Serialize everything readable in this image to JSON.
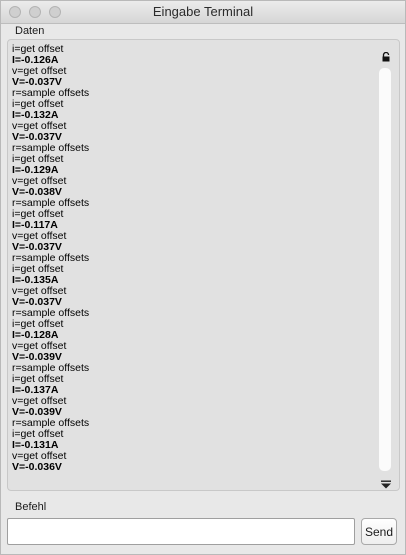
{
  "window": {
    "title": "Eingabe Terminal"
  },
  "output_section": {
    "label": "Daten"
  },
  "input_section": {
    "label": "Befehl"
  },
  "command_input": {
    "value": "",
    "placeholder": ""
  },
  "send_button": {
    "label": "Send"
  },
  "icons": {
    "lock": "lock-icon",
    "scroll_down": "chevron-down-icon"
  },
  "log_lines": [
    {
      "text": "i=get offset",
      "bold": false
    },
    {
      "text": "I=-0.126A",
      "bold": true
    },
    {
      "text": "v=get offset",
      "bold": false
    },
    {
      "text": "V=-0.037V",
      "bold": true
    },
    {
      "text": "r=sample offsets",
      "bold": false
    },
    {
      "text": "i=get offset",
      "bold": false
    },
    {
      "text": "I=-0.132A",
      "bold": true
    },
    {
      "text": "v=get offset",
      "bold": false
    },
    {
      "text": "V=-0.037V",
      "bold": true
    },
    {
      "text": "r=sample offsets",
      "bold": false
    },
    {
      "text": "i=get offset",
      "bold": false
    },
    {
      "text": "I=-0.129A",
      "bold": true
    },
    {
      "text": "v=get offset",
      "bold": false
    },
    {
      "text": "V=-0.038V",
      "bold": true
    },
    {
      "text": "r=sample offsets",
      "bold": false
    },
    {
      "text": "i=get offset",
      "bold": false
    },
    {
      "text": "I=-0.117A",
      "bold": true
    },
    {
      "text": "v=get offset",
      "bold": false
    },
    {
      "text": "V=-0.037V",
      "bold": true
    },
    {
      "text": "r=sample offsets",
      "bold": false
    },
    {
      "text": "i=get offset",
      "bold": false
    },
    {
      "text": "I=-0.135A",
      "bold": true
    },
    {
      "text": "v=get offset",
      "bold": false
    },
    {
      "text": "V=-0.037V",
      "bold": true
    },
    {
      "text": "r=sample offsets",
      "bold": false
    },
    {
      "text": "i=get offset",
      "bold": false
    },
    {
      "text": "I=-0.128A",
      "bold": true
    },
    {
      "text": "v=get offset",
      "bold": false
    },
    {
      "text": "V=-0.039V",
      "bold": true
    },
    {
      "text": "r=sample offsets",
      "bold": false
    },
    {
      "text": "i=get offset",
      "bold": false
    },
    {
      "text": "I=-0.137A",
      "bold": true
    },
    {
      "text": "v=get offset",
      "bold": false
    },
    {
      "text": "V=-0.039V",
      "bold": true
    },
    {
      "text": "r=sample offsets",
      "bold": false
    },
    {
      "text": "i=get offset",
      "bold": false
    },
    {
      "text": "I=-0.131A",
      "bold": true
    },
    {
      "text": "v=get offset",
      "bold": false
    },
    {
      "text": "V=-0.036V",
      "bold": true
    }
  ]
}
